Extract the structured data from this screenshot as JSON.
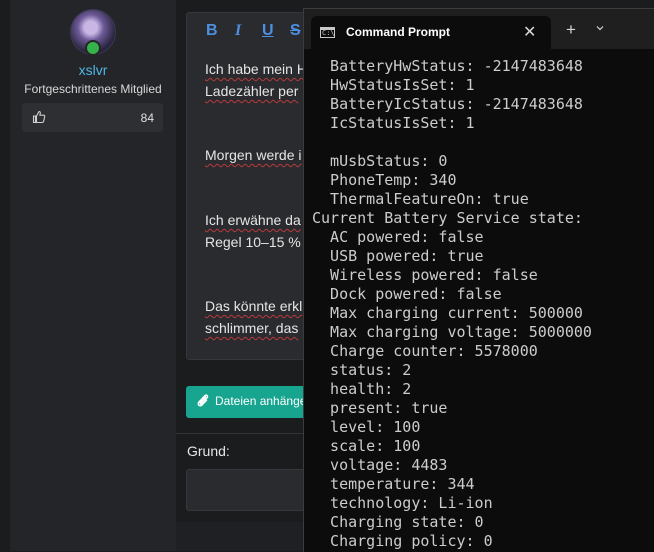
{
  "forum": {
    "username": "xslvr",
    "user_title": "Fortgeschrittenes Mitglied",
    "likes_count": "84",
    "toolbar": {
      "bold": "B",
      "italic": "I",
      "underline": "U",
      "strike": "S"
    },
    "post_lines": [
      "Ich habe mein H",
      "Ladezähler per",
      "Morgen werde i",
      "Ich erwähne da",
      "Regel 10–15 %",
      "Das könnte erkl",
      "schlimmer, das"
    ],
    "attach_label": "Dateien anhänge",
    "reason_label": "Grund:"
  },
  "terminal": {
    "tab_title": "Command Prompt",
    "output_lines": [
      "  BatteryHwStatus: -2147483648",
      "  HwStatusIsSet: 1",
      "  BatteryIcStatus: -2147483648",
      "  IcStatusIsSet: 1",
      "",
      "  mUsbStatus: 0",
      "  PhoneTemp: 340",
      "  ThermalFeatureOn: true",
      "Current Battery Service state:",
      "  AC powered: false",
      "  USB powered: true",
      "  Wireless powered: false",
      "  Dock powered: false",
      "  Max charging current: 500000",
      "  Max charging voltage: 5000000",
      "  Charge counter: 5578000",
      "  status: 2",
      "  health: 2",
      "  present: true",
      "  level: 100",
      "  scale: 100",
      "  voltage: 4483",
      "  temperature: 344",
      "  technology: Li-ion",
      "  Charging state: 0",
      "  Charging policy: 0"
    ]
  },
  "icons": {
    "thumb": "thumbs-up-icon",
    "paperclip": "paperclip-icon",
    "terminal": "cmd-terminal-icon",
    "close": "close-icon",
    "plus": "plus-icon",
    "dropdown": "chevron-down-icon"
  },
  "colors": {
    "username": "#4db6e6",
    "toolbar_accent": "#4d8fe0",
    "attach_button": "#17a58f",
    "online_status": "#36b24a",
    "terminal_bg": "#0c0c0c",
    "terminal_text": "#cccccc"
  }
}
